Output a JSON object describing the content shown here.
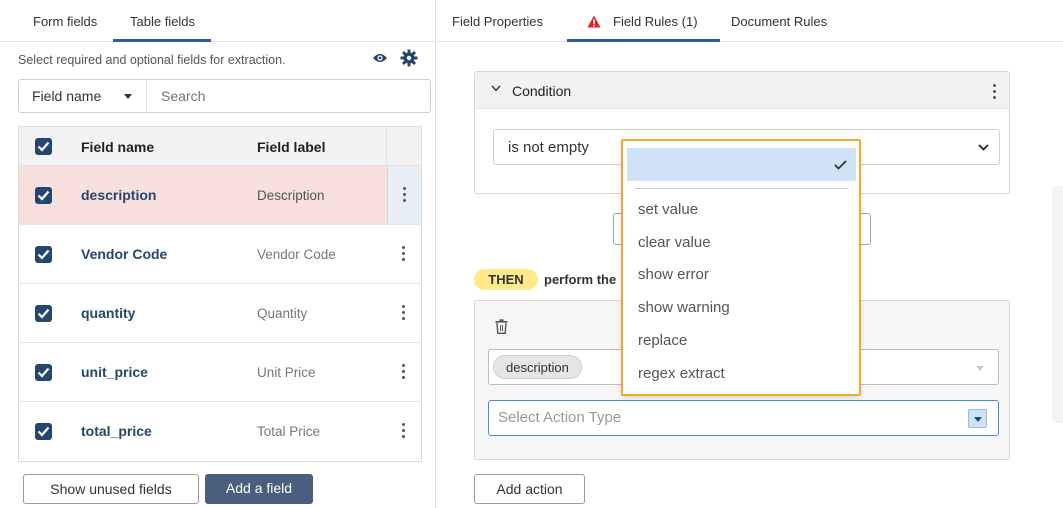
{
  "left_panel": {
    "tabs": [
      {
        "label": "Form fields",
        "active": false
      },
      {
        "label": "Table fields",
        "active": true
      }
    ],
    "hint": "Select required and optional fields for extraction.",
    "filter": {
      "selected": "Field name",
      "search_placeholder": "Search"
    },
    "table": {
      "headers": {
        "name": "Field name",
        "label": "Field label"
      },
      "rows": [
        {
          "name": "description",
          "label": "Description",
          "selected": true
        },
        {
          "name": "Vendor Code",
          "label": "Vendor Code",
          "selected": false
        },
        {
          "name": "quantity",
          "label": "Quantity",
          "selected": false
        },
        {
          "name": "unit_price",
          "label": "Unit Price",
          "selected": false
        },
        {
          "name": "total_price",
          "label": "Total Price",
          "selected": false
        }
      ]
    },
    "buttons": {
      "show_unused": "Show unused fields",
      "add_field": "Add a field"
    }
  },
  "right_panel": {
    "tabs": [
      {
        "label": "Field Properties",
        "active": false
      },
      {
        "label": "Field Rules (1)",
        "active": true,
        "icon": "warning-icon"
      },
      {
        "label": "Document Rules",
        "active": false
      }
    ],
    "condition": {
      "title": "Condition",
      "operator": "is not empty"
    },
    "then": {
      "pill": "THEN",
      "text": "perform the"
    },
    "action": {
      "field_chip": "description",
      "action_type_placeholder": "Select Action Type"
    },
    "add_action": "Add action",
    "dropdown": {
      "options": [
        "set value",
        "clear value",
        "show error",
        "show warning",
        "replace",
        "regex extract"
      ]
    }
  },
  "colors": {
    "brand": "#25466e",
    "selected_row": "#f8e0dc",
    "highlight_border": "#f0a92b",
    "then_pill": "#ffe98a",
    "warning": "#e02020"
  }
}
